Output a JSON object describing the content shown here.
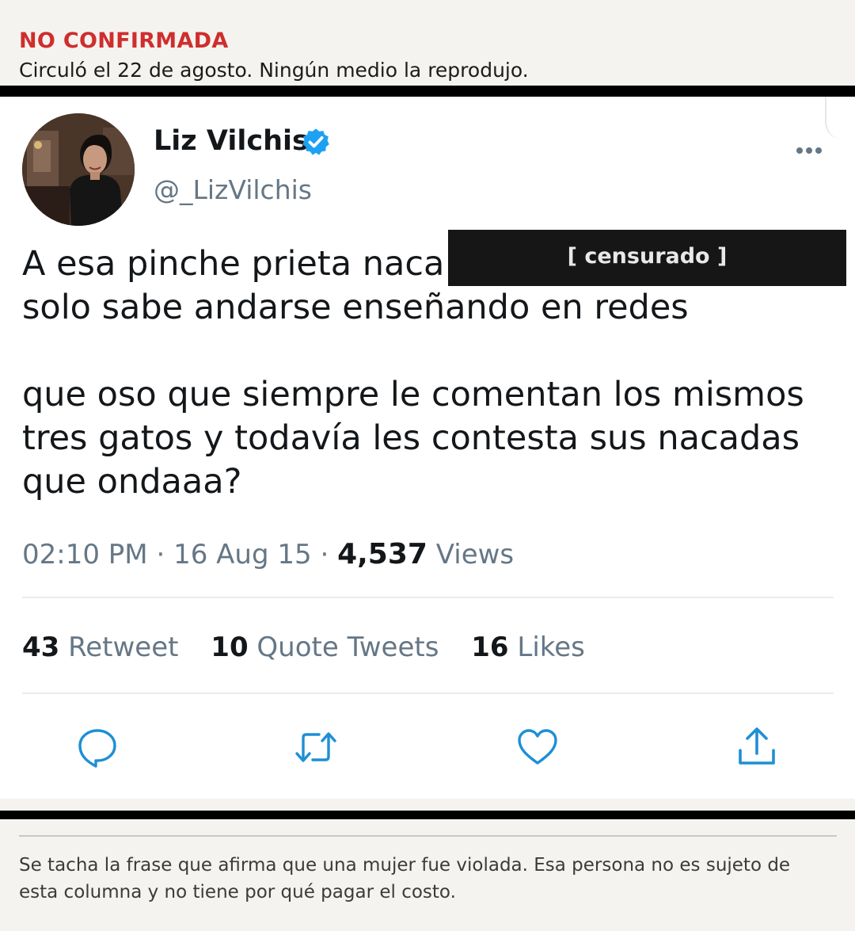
{
  "fact_check": {
    "status_label": "NO CONFIRMADA",
    "note": "Circuló el 22 de agosto. Ningún medio la reprodujo."
  },
  "tweet": {
    "display_name": "Liz Vilchis",
    "handle": "@_LizVilchis",
    "text": "A esa pinche prieta naca\nsolo sabe andarse enseñando en redes\n\nque oso que siempre le comentan los mismos tres gatos y todavía les contesta sus nacadas que ondaaa?",
    "censor_label": "[ censurado ]",
    "time": "02:10 PM",
    "date": "16 Aug 15",
    "views_count": "4,537",
    "views_label": "Views",
    "stats": [
      {
        "count": "43",
        "label": "Retweet"
      },
      {
        "count": "10",
        "label": "Quote Tweets"
      },
      {
        "count": "16",
        "label": "Likes"
      }
    ],
    "icons": {
      "verified": "verified-badge-icon",
      "more": "more-options-icon",
      "reply": "reply-icon",
      "retweet": "retweet-icon",
      "like": "heart-icon",
      "share": "share-icon"
    }
  },
  "footer": {
    "note": "Se tacha la frase que afirma que una mujer fue violada. Esa persona no es sujeto de esta columna y no tiene por qué pagar el costo."
  },
  "colors": {
    "alert_red": "#cf2e2e",
    "verified_blue": "#1da1f2",
    "secondary_text": "#657786",
    "icon_blue": "#1d8fd6",
    "censor_bar": "#161616"
  }
}
